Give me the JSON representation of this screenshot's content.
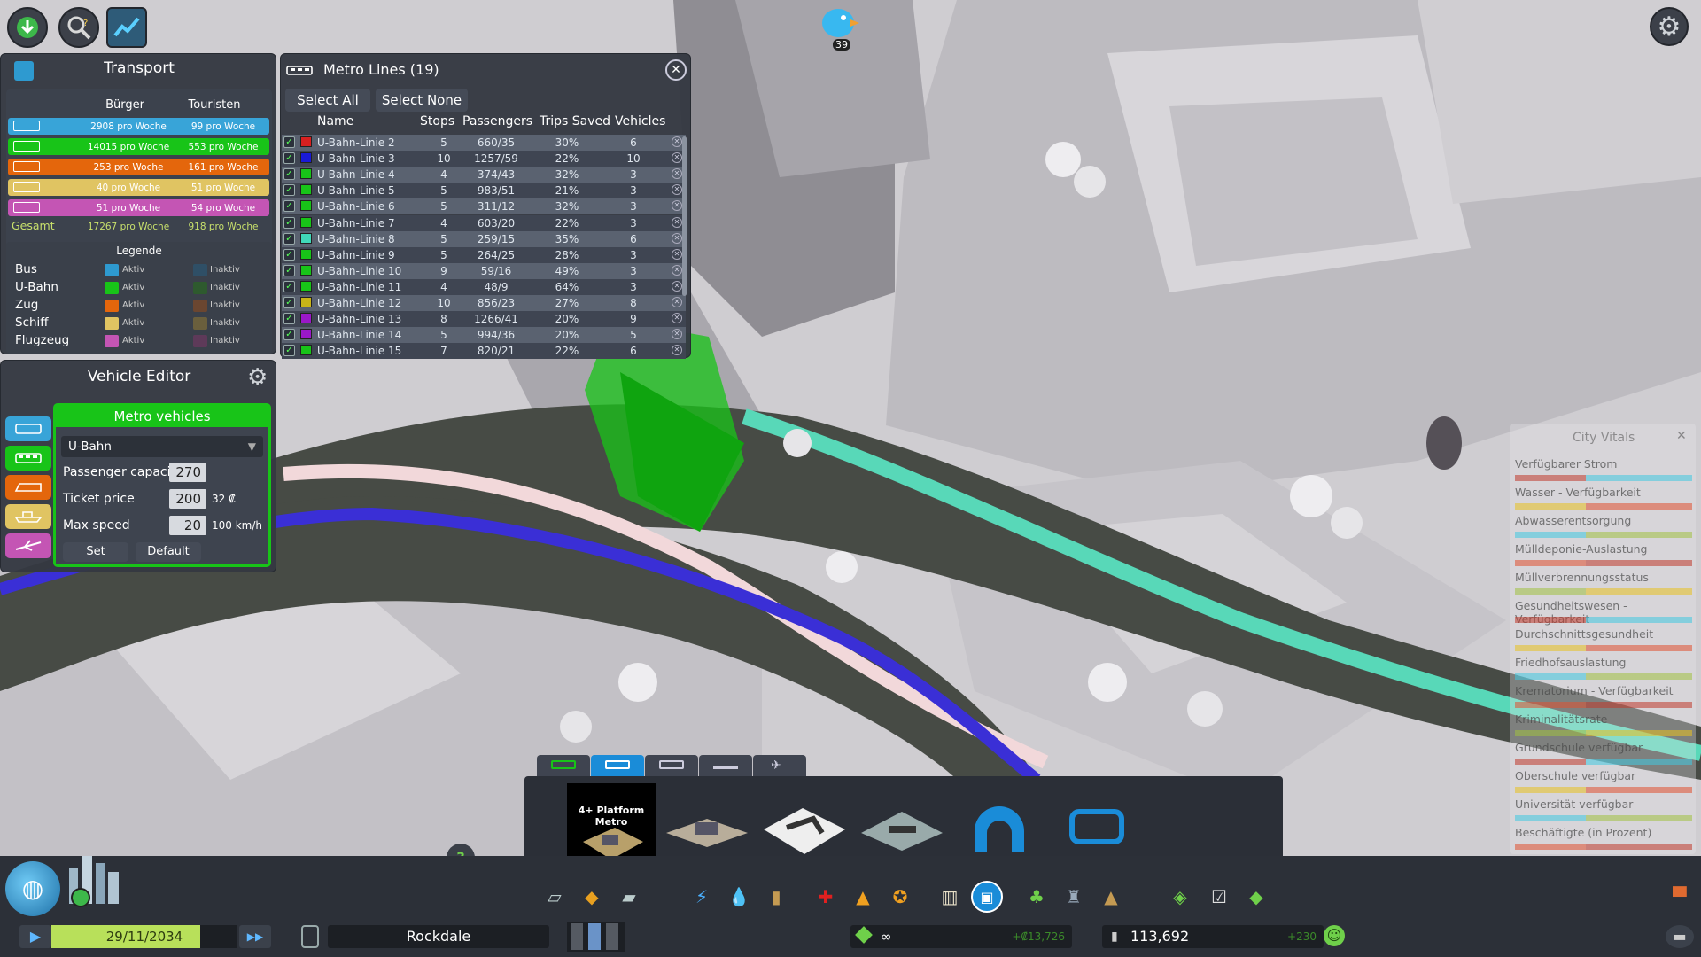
{
  "top": {
    "notification_count": "39"
  },
  "transport": {
    "title": "Transport",
    "col_citizens": "Bürger",
    "col_tourists": "Touristen",
    "rows": [
      {
        "mode": "bus",
        "citizens": "2908 pro Woche",
        "tourists": "99 pro Woche",
        "color": "#38a4d8"
      },
      {
        "mode": "metro",
        "citizens": "14015 pro Woche",
        "tourists": "553 pro Woche",
        "color": "#18c418"
      },
      {
        "mode": "train",
        "citizens": "253 pro Woche",
        "tourists": "161 pro Woche",
        "color": "#e4660c"
      },
      {
        "mode": "ship",
        "citizens": "40 pro Woche",
        "tourists": "51 pro Woche",
        "color": "#e0c462"
      },
      {
        "mode": "plane",
        "citizens": "51 pro Woche",
        "tourists": "54 pro Woche",
        "color": "#c455b4"
      }
    ],
    "total_label": "Gesamt",
    "total_citizens": "17267 pro Woche",
    "total_tourists": "918 pro Woche",
    "legend_title": "Legende",
    "legend": [
      {
        "label": "Bus",
        "active": "Aktiv",
        "inactive": "Inaktiv",
        "ac": "#2e9ad0",
        "ic": "#2f4f66"
      },
      {
        "label": "U-Bahn",
        "active": "Aktiv",
        "inactive": "Inaktiv",
        "ac": "#18c418",
        "ic": "#2e5a2e"
      },
      {
        "label": "Zug",
        "active": "Aktiv",
        "inactive": "Inaktiv",
        "ac": "#e4660c",
        "ic": "#6b4630"
      },
      {
        "label": "Schiff",
        "active": "Aktiv",
        "inactive": "Inaktiv",
        "ac": "#e0c462",
        "ic": "#6a5f3d"
      },
      {
        "label": "Flugzeug",
        "active": "Aktiv",
        "inactive": "Inaktiv",
        "ac": "#c455b4",
        "ic": "#5e3a59"
      }
    ]
  },
  "metro": {
    "title": "Metro Lines (19)",
    "select_all": "Select All",
    "select_none": "Select None",
    "headers": {
      "name": "Name",
      "stops": "Stops",
      "passengers": "Passengers",
      "trips": "Trips Saved",
      "vehicles": "Vehicles"
    },
    "lines": [
      {
        "name": "U-Bahn-Linie 2",
        "stops": "5",
        "pass": "660/35",
        "trips": "30%",
        "veh": "6",
        "color": "#d82020"
      },
      {
        "name": "U-Bahn-Linie 3",
        "stops": "10",
        "pass": "1257/59",
        "trips": "22%",
        "veh": "10",
        "color": "#1a1ad6"
      },
      {
        "name": "U-Bahn-Linie 4",
        "stops": "4",
        "pass": "374/43",
        "trips": "32%",
        "veh": "3",
        "color": "#18c418"
      },
      {
        "name": "U-Bahn-Linie 5",
        "stops": "5",
        "pass": "983/51",
        "trips": "21%",
        "veh": "3",
        "color": "#18c418"
      },
      {
        "name": "U-Bahn-Linie 6",
        "stops": "5",
        "pass": "311/12",
        "trips": "32%",
        "veh": "3",
        "color": "#18c418"
      },
      {
        "name": "U-Bahn-Linie 7",
        "stops": "4",
        "pass": "603/20",
        "trips": "22%",
        "veh": "3",
        "color": "#18c418"
      },
      {
        "name": "U-Bahn-Linie 8",
        "stops": "5",
        "pass": "259/15",
        "trips": "35%",
        "veh": "6",
        "color": "#40d8b8"
      },
      {
        "name": "U-Bahn-Linie 9",
        "stops": "5",
        "pass": "264/25",
        "trips": "28%",
        "veh": "3",
        "color": "#18c418"
      },
      {
        "name": "U-Bahn-Linie 10",
        "stops": "9",
        "pass": "59/16",
        "trips": "49%",
        "veh": "3",
        "color": "#18c418"
      },
      {
        "name": "U-Bahn-Linie 11",
        "stops": "4",
        "pass": "48/9",
        "trips": "64%",
        "veh": "3",
        "color": "#18c418"
      },
      {
        "name": "U-Bahn-Linie 12",
        "stops": "10",
        "pass": "856/23",
        "trips": "27%",
        "veh": "8",
        "color": "#c8b418"
      },
      {
        "name": "U-Bahn-Linie 13",
        "stops": "8",
        "pass": "1266/41",
        "trips": "20%",
        "veh": "9",
        "color": "#9a18c8"
      },
      {
        "name": "U-Bahn-Linie 14",
        "stops": "5",
        "pass": "994/36",
        "trips": "20%",
        "veh": "5",
        "color": "#9a18c8"
      },
      {
        "name": "U-Bahn-Linie 15",
        "stops": "7",
        "pass": "820/21",
        "trips": "22%",
        "veh": "6",
        "color": "#18c418"
      }
    ]
  },
  "vehicle_editor": {
    "title": "Vehicle Editor",
    "section": "Metro vehicles",
    "dropdown": "U-Bahn",
    "capacity_label": "Passenger capacity",
    "capacity": "270",
    "price_label": "Ticket price",
    "price": "200",
    "price_unit": "32 ₡",
    "speed_label": "Max speed",
    "speed": "20",
    "speed_unit": "100 km/h",
    "set": "Set",
    "default": "Default"
  },
  "vitals": {
    "title": "City Vitals",
    "items": [
      "Verfügbarer Strom",
      "Wasser - Verfügbarkeit",
      "Abwasserentsorgung",
      "Mülldeponie-Auslastung",
      "Müllverbrennungsstatus",
      "Gesundheitswesen - Verfügbarkeit",
      "Durchschnittsgesundheit",
      "Friedhofsauslastung",
      "Krematorium - Verfügbarkeit",
      "Kriminalitätsrate",
      "Grundschule verfügbar",
      "Oberschule verfügbar",
      "Universität verfügbar",
      "Beschäftigte (in Prozent)"
    ]
  },
  "builder": {
    "asset_label": "4+ Platform Metro"
  },
  "status": {
    "date": "29/11/2034",
    "city": "Rockdale",
    "money": "∞",
    "income": "+₡13,726",
    "population": "113,692",
    "pop_change": "+230"
  },
  "colors": {
    "metro_green": "#18c418",
    "accent_blue": "#1a8cd8"
  }
}
